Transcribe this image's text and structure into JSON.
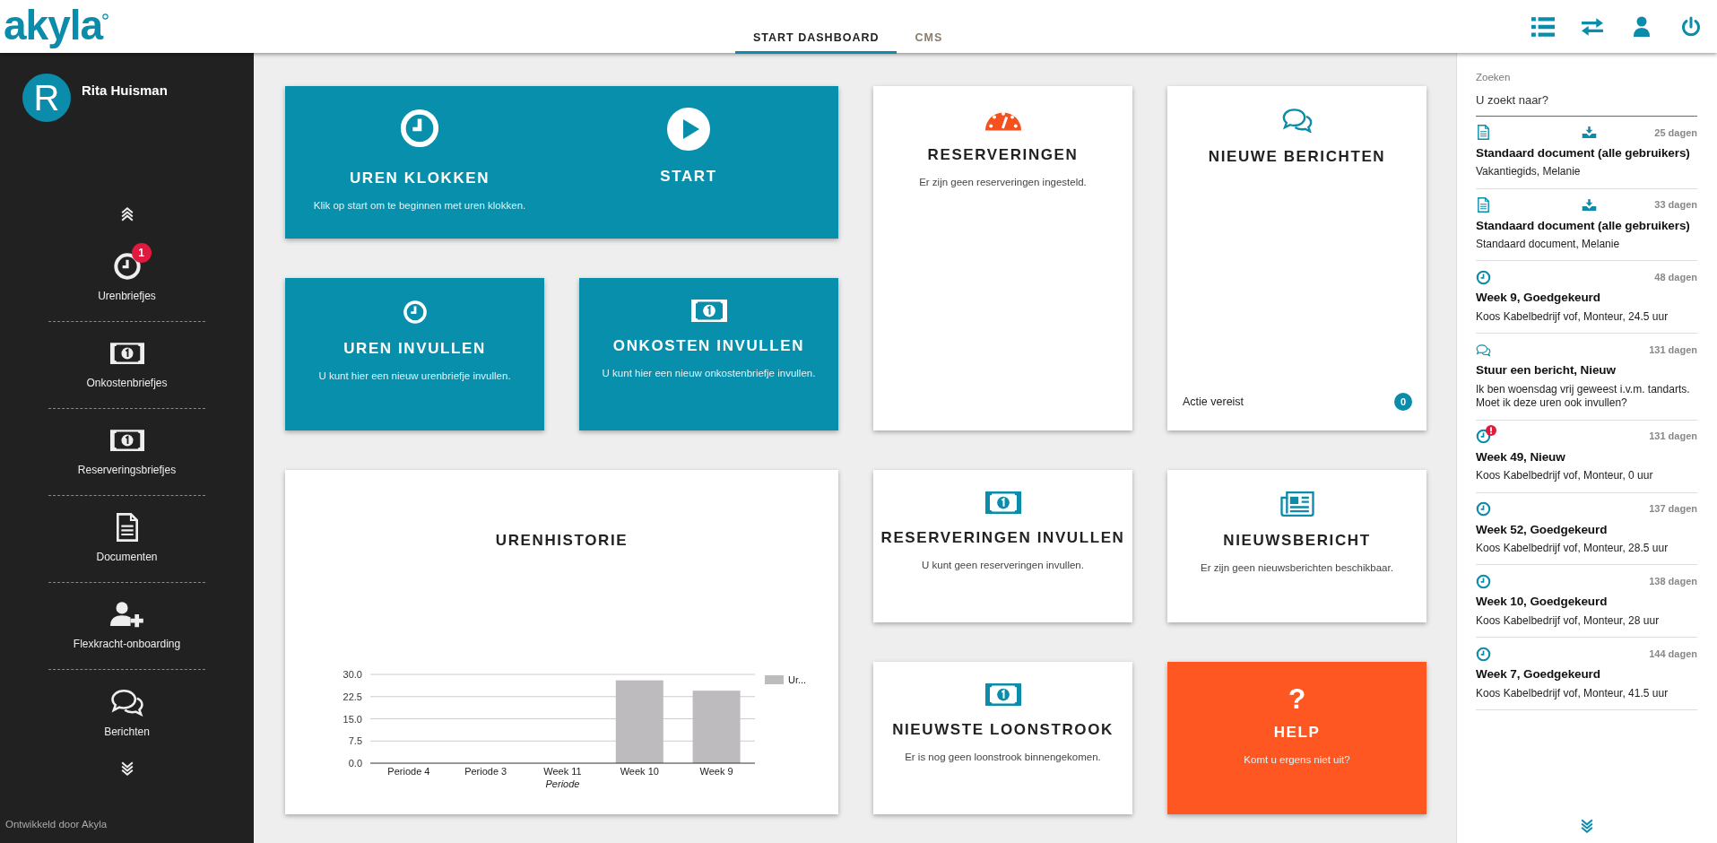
{
  "header": {
    "logo": "akyla",
    "tabs": [
      {
        "label": "START DASHBOARD",
        "selected": true
      },
      {
        "label": "CMS",
        "selected": false
      }
    ]
  },
  "sidebar": {
    "user": {
      "initial": "R",
      "name": "Rita Huisman"
    },
    "items": [
      {
        "label": "Urenbriefjes",
        "badge": "1"
      },
      {
        "label": "Onkostenbriefjes"
      },
      {
        "label": "Reserveringsbriefjes"
      },
      {
        "label": "Documenten"
      },
      {
        "label": "Flexkracht-onboarding"
      },
      {
        "label": "Berichten"
      }
    ],
    "footer": "Ontwikkeld door Akyla"
  },
  "dashboard": {
    "clock_in": {
      "title": "UREN KLOKKEN",
      "text": "Klik op start om te beginnen met uren klokken.",
      "start": "START"
    },
    "hours_entry": {
      "title": "UREN INVULLEN",
      "text": "U kunt hier een nieuw urenbriefje invullen."
    },
    "expenses_entry": {
      "title": "ONKOSTEN INVULLEN",
      "text": "U kunt hier een nieuw onkostenbriefje invullen."
    },
    "reservations": {
      "title": "RESERVERINGEN",
      "text": "Er zijn geen reserveringen ingesteld."
    },
    "messages": {
      "title": "NIEUWE BERICHTEN",
      "action_label": "Actie vereist",
      "action_count": "0"
    },
    "history": {
      "title": "URENHISTORIE",
      "chart_data": {
        "type": "bar",
        "xlabel": "Periode",
        "categories": [
          "Periode 4",
          "Periode 3",
          "Week 11",
          "Week 10",
          "Week 9"
        ],
        "series": [
          {
            "name": "Ur...",
            "color": "#bdbbbe",
            "values": [
              0,
              0,
              0,
              28,
              24.5
            ]
          }
        ],
        "ylim": [
          0,
          30
        ],
        "grid": true,
        "yticks": [
          {
            "value": 0,
            "label": "0.0"
          },
          {
            "value": 7.5,
            "label": "7.5"
          },
          {
            "value": 15,
            "label": "15.0"
          },
          {
            "value": 22.5,
            "label": "22.5"
          },
          {
            "value": 30,
            "label": "30.0"
          }
        ]
      }
    },
    "reservations_entry": {
      "title": "RESERVERINGEN INVULLEN",
      "text": "U kunt geen reserveringen invullen."
    },
    "news": {
      "title": "NIEUWSBERICHT",
      "text": "Er zijn geen nieuwsberichten beschikbaar."
    },
    "payslip": {
      "title": "NIEUWSTE LOONSTROOK",
      "text": "Er is nog geen loonstrook binnengekomen."
    },
    "help": {
      "icon": "?",
      "title": "HELP",
      "text": "Komt u ergens niet uit?"
    }
  },
  "feed": {
    "search": {
      "label": "Zoeken",
      "placeholder": "U zoekt naar?"
    },
    "items": [
      {
        "kind": "document",
        "age": "25 dagen",
        "title": "Standaard document (alle gebruikers)",
        "subtitle": "Vakantiegids, Melanie",
        "alert": false
      },
      {
        "kind": "document",
        "age": "33 dagen",
        "title": "Standaard document (alle gebruikers)",
        "subtitle": "Standaard document, Melanie",
        "alert": false
      },
      {
        "kind": "timesheet",
        "age": "48 dagen",
        "title": "Week 9, Goedgekeurd",
        "subtitle": "Koos Kabelbedrijf vof, Monteur, 24.5 uur",
        "alert": false
      },
      {
        "kind": "message",
        "age": "131 dagen",
        "title": "Stuur een bericht, Nieuw",
        "subtitle": "Ik ben woensdag vrij geweest i.v.m. tandarts. Moet ik deze uren ook invullen?",
        "alert": false
      },
      {
        "kind": "timesheet",
        "age": "131 dagen",
        "title": "Week 49, Nieuw",
        "subtitle": "Koos Kabelbedrijf vof, Monteur, 0 uur",
        "alert": true
      },
      {
        "kind": "timesheet",
        "age": "137 dagen",
        "title": "Week 52, Goedgekeurd",
        "subtitle": "Koos Kabelbedrijf vof, Monteur, 28.5 uur",
        "alert": false
      },
      {
        "kind": "timesheet",
        "age": "138 dagen",
        "title": "Week 10, Goedgekeurd",
        "subtitle": "Koos Kabelbedrijf vof, Monteur, 28 uur",
        "alert": false
      },
      {
        "kind": "timesheet",
        "age": "144 dagen",
        "title": "Week 7, Goedgekeurd",
        "subtitle": "Koos Kabelbedrijf vof, Monteur, 41.5 uur",
        "alert": false
      }
    ]
  }
}
